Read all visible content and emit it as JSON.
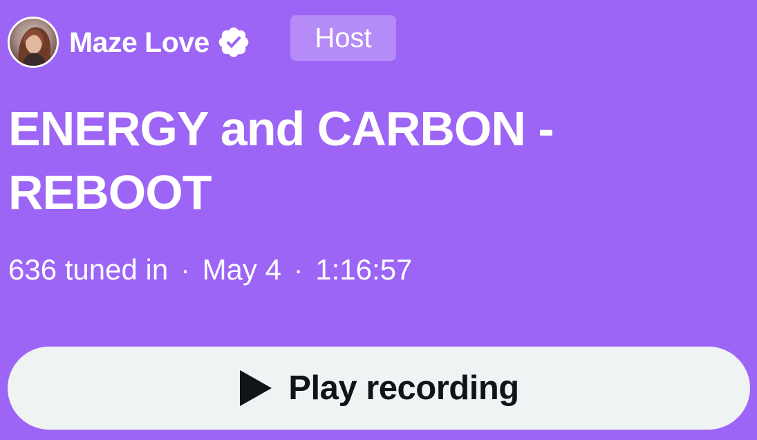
{
  "host": {
    "name": "Maze Love",
    "badge": "Host",
    "verified_icon": "verified-badge-icon",
    "avatar": "host-avatar"
  },
  "space": {
    "title": "ENERGY and CARBON - REBOOT",
    "listeners": "636 tuned in",
    "date": "May 4",
    "duration": "1:16:57",
    "separator": "·"
  },
  "actions": {
    "play_label": "Play recording",
    "play_icon": "play-icon"
  },
  "colors": {
    "background": "#9c65f5",
    "button_background": "#eff3f4",
    "button_text": "#0f1419",
    "text": "#ffffff"
  }
}
